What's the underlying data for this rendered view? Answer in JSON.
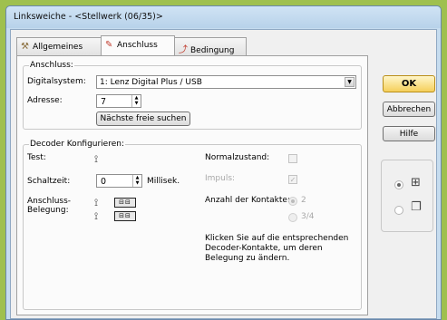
{
  "window": {
    "title": "Linksweiche - <Stellwerk (06/35)>"
  },
  "tabs": [
    {
      "label": "Allgemeines",
      "icon": "tools-icon"
    },
    {
      "label": "Anschluss",
      "icon": "plug-icon",
      "active": true
    },
    {
      "label": "Bedingung",
      "icon": "condition-icon"
    }
  ],
  "anschluss": {
    "legend": "Anschluss:",
    "digitalsystem_label": "Digitalsystem:",
    "digitalsystem_value": "1: Lenz Digital Plus / USB",
    "adresse_label": "Adresse:",
    "adresse_value": "7",
    "next_free_button": "Nächste freie suchen"
  },
  "decoder": {
    "legend": "Decoder Konfigurieren:",
    "test_label": "Test:",
    "schaltzeit_label": "Schaltzeit:",
    "schaltzeit_value": "0",
    "schaltzeit_unit": "Millisek.",
    "belegung_label_1": "Anschluss-",
    "belegung_label_2": "Belegung:",
    "normalzustand_label": "Normalzustand:",
    "impuls_label": "Impuls:",
    "kontakte_label": "Anzahl der Kontakte:",
    "kontakte_option_1": "2",
    "kontakte_option_2": "3/4",
    "hint": "Klicken Sie auf die entsprechenden Decoder-Kontakte, um deren Belegung zu ändern."
  },
  "buttons": {
    "ok": "OK",
    "abbrechen": "Abbrechen",
    "hilfe": "Hilfe"
  },
  "view_options": [
    {
      "icon": "grid-view-icon",
      "selected": true
    },
    {
      "icon": "layers-view-icon",
      "selected": false
    }
  ],
  "colors": {
    "accent_ok": "#f5cf5a",
    "frame": "#c6dcef",
    "background": "#9fc04e"
  }
}
